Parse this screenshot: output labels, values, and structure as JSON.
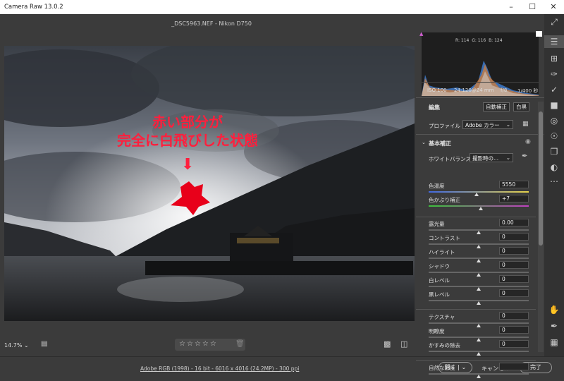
{
  "window": {
    "title": "Camera Raw 13.0.2"
  },
  "header": {
    "filename": "_DSC5963.NEF  -  Nikon D750"
  },
  "annotation": {
    "line1": "赤い部分が",
    "line2": "完全に白飛びした状態"
  },
  "histogram": {
    "r": "R: 114",
    "g": "G: 116",
    "b": "B: 124"
  },
  "camera_info": {
    "iso": "ISO 100",
    "lens": "24-120@24 mm",
    "aperture": "f/8",
    "shutter": "1/400 秒"
  },
  "edit": {
    "title": "編集",
    "auto_label": "自動補正",
    "bw_label": "白黒"
  },
  "profile": {
    "label": "プロファイル",
    "value": "Adobe カラー"
  },
  "basic": {
    "title": "基本補正",
    "wb_label": "ホワイトバランス",
    "wb_value": "撮影時の..."
  },
  "sliders": [
    {
      "label": "色温度",
      "value": "5550",
      "pos": 0.48
    },
    {
      "label": "色かぶり補正",
      "value": "+7",
      "pos": 0.52
    },
    {
      "label": "露光量",
      "value": "0.00",
      "pos": 0.5
    },
    {
      "label": "コントラスト",
      "value": "0",
      "pos": 0.5
    },
    {
      "label": "ハイライト",
      "value": "0",
      "pos": 0.5
    },
    {
      "label": "シャドウ",
      "value": "0",
      "pos": 0.5
    },
    {
      "label": "白レベル",
      "value": "0",
      "pos": 0.5
    },
    {
      "label": "黒レベル",
      "value": "0",
      "pos": 0.5
    },
    {
      "label": "テクスチャ",
      "value": "0",
      "pos": 0.5
    },
    {
      "label": "明瞭度",
      "value": "0",
      "pos": 0.5
    },
    {
      "label": "かすみの除去",
      "value": "0",
      "pos": 0.5
    },
    {
      "label": "自然な彩度",
      "value": "",
      "pos": 0.5
    }
  ],
  "bottom": {
    "zoom": "14.7%",
    "stars": [
      "☆",
      "☆",
      "☆",
      "☆",
      "☆"
    ]
  },
  "footer": {
    "info": "Adobe RGB (1998) - 16 bit - 6016 x 4016 (24.2MP) - 300 ppi",
    "open": "開く",
    "cancel": "キャンセル",
    "done": "完了"
  }
}
